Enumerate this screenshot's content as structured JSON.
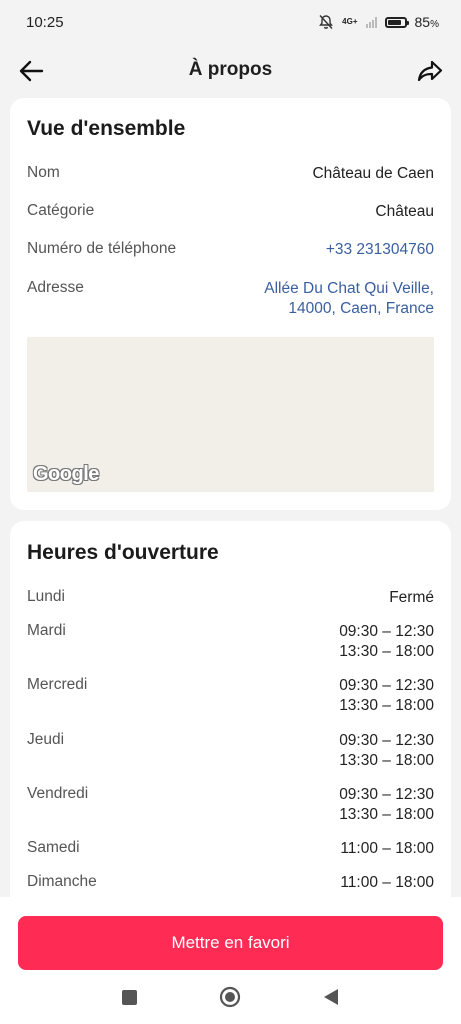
{
  "status_bar": {
    "time": "10:25",
    "network": "4G+",
    "battery_percent": "85",
    "battery_suffix": "%",
    "battery_level": 0.85
  },
  "header": {
    "title": "À propos",
    "back_icon": "arrow-left-icon",
    "share_icon": "share-arrow-icon"
  },
  "overview": {
    "title": "Vue d'ensemble",
    "rows": [
      {
        "label": "Nom",
        "value": "Château de Caen"
      },
      {
        "label": "Catégorie",
        "value": "Château"
      },
      {
        "label": "Numéro de téléphone",
        "value": "+33 231304760"
      },
      {
        "label": "Adresse",
        "value_line1": "Allée Du Chat Qui Veille,",
        "value_line2": "14000, Caen, France"
      }
    ],
    "map_logo": "Google"
  },
  "hours": {
    "title": "Heures d'ouverture",
    "days": [
      {
        "day": "Lundi",
        "lines": [
          "Fermé"
        ]
      },
      {
        "day": "Mardi",
        "lines": [
          "09:30 – 12:30",
          "13:30 – 18:00"
        ]
      },
      {
        "day": "Mercredi",
        "lines": [
          "09:30 – 12:30",
          "13:30 – 18:00"
        ]
      },
      {
        "day": "Jeudi",
        "lines": [
          "09:30 – 12:30",
          "13:30 – 18:00"
        ]
      },
      {
        "day": "Vendredi",
        "lines": [
          "09:30 – 12:30",
          "13:30 – 18:00"
        ]
      },
      {
        "day": "Samedi",
        "lines": [
          "11:00 – 18:00"
        ]
      },
      {
        "day": "Dimanche",
        "lines": [
          "11:00 – 18:00"
        ]
      }
    ]
  },
  "bottom": {
    "favorite_label": "Mettre en favori",
    "accent": "#fe2c55"
  },
  "colors": {
    "link": "#3a5fa0",
    "map": "#f1efe8"
  }
}
